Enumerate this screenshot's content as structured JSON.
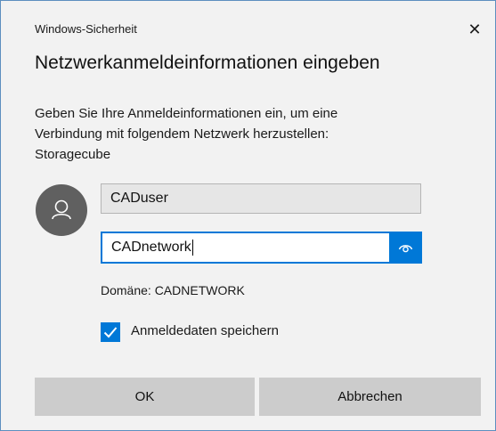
{
  "window": {
    "title": "Windows-Sicherheit",
    "close_glyph": "✕"
  },
  "dialog": {
    "heading": "Netzwerkanmeldeinformationen eingeben",
    "description_lines": [
      "Geben Sie Ihre Anmeldeinformationen ein, um eine",
      "Verbindung mit folgendem Netzwerk herzustellen:",
      "Storagecube"
    ]
  },
  "form": {
    "avatar_icon": "user-icon",
    "username_value": "CADuser",
    "password_value": "CADnetwork",
    "reveal_icon": "eye-icon",
    "domain_text": "Domäne: CADNETWORK",
    "remember_checked": true,
    "remember_label": "Anmeldedaten speichern"
  },
  "buttons": {
    "ok_label": "OK",
    "cancel_label": "Abbrechen"
  },
  "colors": {
    "accent": "#0078d7",
    "dialog_background": "#f2f2f2",
    "button_background": "#cccccc",
    "avatar_background": "#606060"
  }
}
